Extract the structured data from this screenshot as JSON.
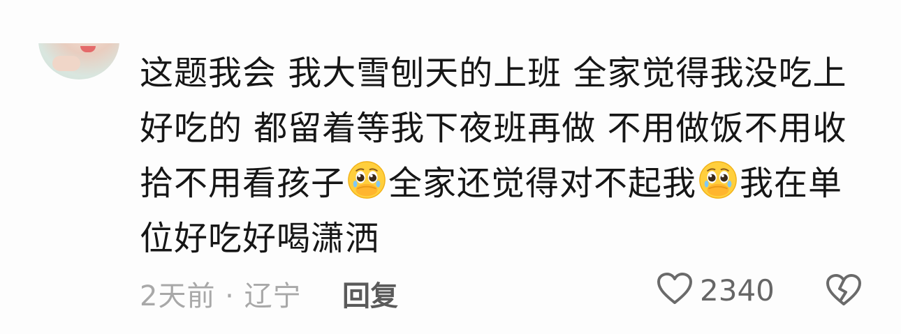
{
  "comment": {
    "segments": [
      "这题我会 我大雪刨天的上班 全家觉得我没吃上好吃的 都留着等我下夜班再做 不用做饭不用收拾不用看孩子",
      "全家还觉得对不起我",
      "我在单位好吃好喝潇洒"
    ],
    "emoji": "pleading-face-hands-over-mouth",
    "time": "2天前",
    "separator": "·",
    "location": "辽宁",
    "reply_label": "回复",
    "like_count": "2340"
  }
}
